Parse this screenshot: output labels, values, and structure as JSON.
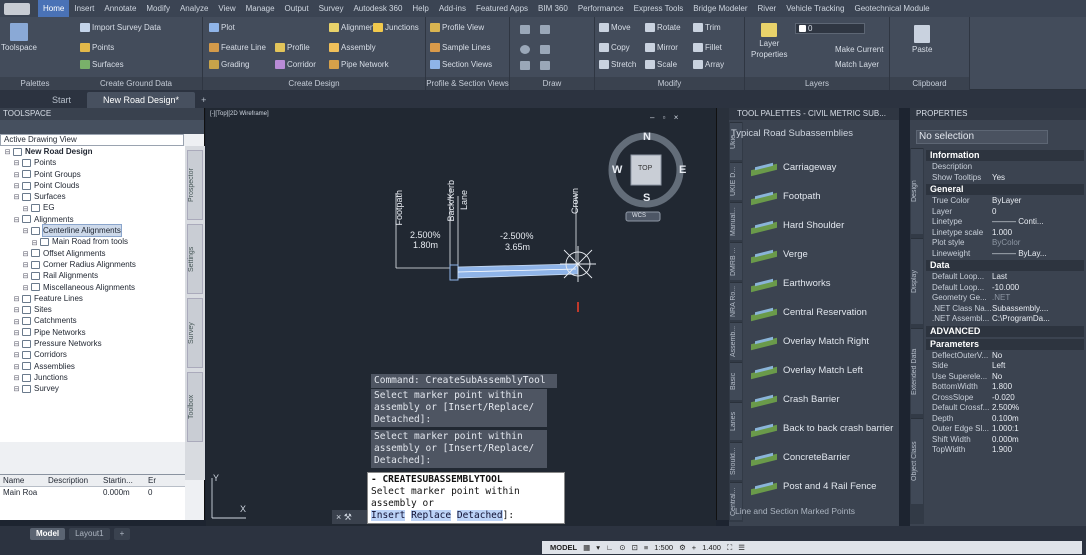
{
  "ribbon": {
    "tabs": [
      "Home",
      "Insert",
      "Annotate",
      "Modify",
      "Analyze",
      "View",
      "Manage",
      "Output",
      "Survey",
      "Autodesk 360",
      "Help",
      "Add-ins",
      "Featured Apps",
      "BIM 360",
      "Performance",
      "Express Tools",
      "Bridge Modeler",
      "River",
      "Vehicle Tracking",
      "Geotechnical Module"
    ],
    "active_tab": "Home",
    "toolspace_label": "Toolspace",
    "palettes": {
      "import_survey": "Import Survey Data",
      "points": "Points",
      "surfaces": "Surfaces",
      "title": "Palettes"
    },
    "ground_data_title": "Create Ground Data",
    "design": {
      "plot": "Plot",
      "feature_line": "Feature Line",
      "grading": "Grading",
      "alignment": "Alignment",
      "profile": "Profile",
      "corridor": "Corridor",
      "junctions": "Junctions",
      "assembly": "Assembly",
      "pipe_network": "Pipe Network",
      "title": "Create Design"
    },
    "profile_section": {
      "profile_view": "Profile View",
      "sample_lines": "Sample Lines",
      "section_views": "Section Views",
      "title": "Profile & Section Views"
    },
    "draw_title": "Draw",
    "modify": {
      "move": "Move",
      "rotate": "Rotate",
      "trim": "Trim",
      "copy": "Copy",
      "mirror": "Mirror",
      "fillet": "Fillet",
      "stretch": "Stretch",
      "scale": "Scale",
      "array": "Array",
      "title": "Modify"
    },
    "layers": {
      "layer": "Layer",
      "properties": "Properties",
      "make_current": "Make Current",
      "match_layer": "Match Layer",
      "current": "0",
      "title": "Layers"
    },
    "clipboard": {
      "paste": "Paste",
      "title": "Clipboard"
    }
  },
  "doc_tabs": {
    "start": "Start",
    "current": "New Road Design*"
  },
  "toolspace": {
    "title": "TOOLSPACE",
    "view_selector": "Active Drawing View",
    "side_tabs": [
      "Prospector",
      "Settings",
      "Survey",
      "Toolbox"
    ],
    "tree": [
      {
        "label": "New Road Design",
        "indent": 0,
        "bold": true
      },
      {
        "label": "Points",
        "indent": 1
      },
      {
        "label": "Point Groups",
        "indent": 1
      },
      {
        "label": "Point Clouds",
        "indent": 1
      },
      {
        "label": "Surfaces",
        "indent": 1
      },
      {
        "label": "EG",
        "indent": 2
      },
      {
        "label": "Alignments",
        "indent": 1
      },
      {
        "label": "Centerline Alignments",
        "indent": 2,
        "selected": true
      },
      {
        "label": "Main Road from tools",
        "indent": 3
      },
      {
        "label": "Offset Alignments",
        "indent": 2
      },
      {
        "label": "Corner Radius Alignments",
        "indent": 2
      },
      {
        "label": "Rail Alignments",
        "indent": 2
      },
      {
        "label": "Miscellaneous Alignments",
        "indent": 2
      },
      {
        "label": "Feature Lines",
        "indent": 1
      },
      {
        "label": "Sites",
        "indent": 1
      },
      {
        "label": "Catchments",
        "indent": 1
      },
      {
        "label": "Pipe Networks",
        "indent": 1
      },
      {
        "label": "Pressure Networks",
        "indent": 1
      },
      {
        "label": "Corridors",
        "indent": 1
      },
      {
        "label": "Assemblies",
        "indent": 1
      },
      {
        "label": "Junctions",
        "indent": 1
      },
      {
        "label": "Survey",
        "indent": 1
      }
    ],
    "grid": {
      "headers": [
        "Name",
        "Description",
        "Startin...",
        "Er"
      ],
      "row": [
        "Main Roa",
        "",
        "0.000m",
        "0"
      ]
    }
  },
  "viewport": {
    "label": "[-][Top][2D Wireframe]",
    "compass": {
      "n": "N",
      "s": "S",
      "e": "E",
      "w": "W",
      "top": "TOP",
      "wcs": "WCS"
    },
    "annotations": {
      "footpath": "Footpath",
      "back_kerb": "Back/Kerb",
      "lane": "Lane",
      "crown": "Crown",
      "slope1": "2.500%",
      "width1": "1.80m",
      "slope2": "-2.500%",
      "width2": "3.65m"
    },
    "axis": {
      "x": "X",
      "y": "Y"
    }
  },
  "command": {
    "history": [
      "Command: CreateSubAssemblyTool",
      "Select marker point within\nassembly or [Insert/Replace/\nDetached]:",
      "Select marker point within\nassembly or [Insert/Replace/\nDetached]:"
    ],
    "current_title": "- CREATESUBASSEMBLYTOOL",
    "current_prompt": "Select marker point within",
    "current_prompt2": "assembly or",
    "options": [
      "Insert",
      "Replace",
      "Detached"
    ],
    "close_glyph": "×"
  },
  "tool_palettes": {
    "title": "TOOL PALETTES - CIVIL METRIC SUB...",
    "heading": "Typical Road Subassemblies",
    "side_tabs": [
      "Ukie",
      "UKIE D...",
      "Manual...",
      "DMRB ...",
      "NRA Ro...",
      "Assemb...",
      "Basic",
      "Lanes",
      "Should...",
      "Central..."
    ],
    "items": [
      "Carriageway",
      "Footpath",
      "Hard Shoulder",
      "Verge",
      "Earthworks",
      "Central Reservation",
      "Overlay Match Right",
      "Overlay Match Left",
      "Crash Barrier",
      "Back to back crash barrier",
      "ConcreteBarrier",
      "Post and 4 Rail Fence"
    ],
    "footer": "Line and Section Marked Points"
  },
  "properties": {
    "title": "PROPERTIES",
    "selection": "No selection",
    "side_tabs": [
      "Design",
      "Display",
      "Extended Data",
      "Object Class"
    ],
    "sections": {
      "information": {
        "title": "Information",
        "rows": [
          [
            "Description",
            ""
          ],
          [
            "Show Tooltips",
            "Yes"
          ]
        ]
      },
      "general": {
        "title": "General",
        "rows": [
          [
            "True Color",
            "ByLayer"
          ],
          [
            "Layer",
            "0"
          ],
          [
            "Linetype",
            "——— Conti..."
          ],
          [
            "Linetype scale",
            "1.000"
          ],
          [
            "Plot style",
            "ByColor"
          ],
          [
            "Lineweight",
            "——— ByLay..."
          ]
        ]
      },
      "data": {
        "title": "Data",
        "rows": [
          [
            "Default Loop...",
            "Last"
          ],
          [
            "Default Loop...",
            "-10.000"
          ],
          [
            "Geometry Ge...",
            ".NET"
          ],
          [
            ".NET Class Na...",
            "Subassembly...."
          ],
          [
            ".NET Assembl...",
            "C:\\ProgramDa..."
          ]
        ]
      },
      "advanced": {
        "title": "ADVANCED"
      },
      "parameters": {
        "title": "Parameters",
        "rows": [
          [
            "DeflectOuterV...",
            "No"
          ],
          [
            "Side",
            "Left"
          ],
          [
            "Use Superele...",
            "No"
          ],
          [
            "BottomWidth",
            "1.800"
          ],
          [
            "CrossSlope",
            "-0.020"
          ],
          [
            "Default Crossf...",
            "2.500%"
          ],
          [
            "Depth",
            "0.100m"
          ],
          [
            "Outer Edge Sl...",
            "1.000:1"
          ],
          [
            "Shift Width",
            "0.000m"
          ],
          [
            "TopWidth",
            "1.900"
          ]
        ]
      }
    }
  },
  "layout_tabs": [
    "Model",
    "Layout1",
    "+"
  ],
  "status": {
    "mode": "MODEL",
    "scale": "1:500",
    "zoom": "1.400"
  },
  "colors": {
    "accent": "#4a72b6",
    "background": "#212832",
    "subassembly_blue": "#8fb4e8"
  }
}
